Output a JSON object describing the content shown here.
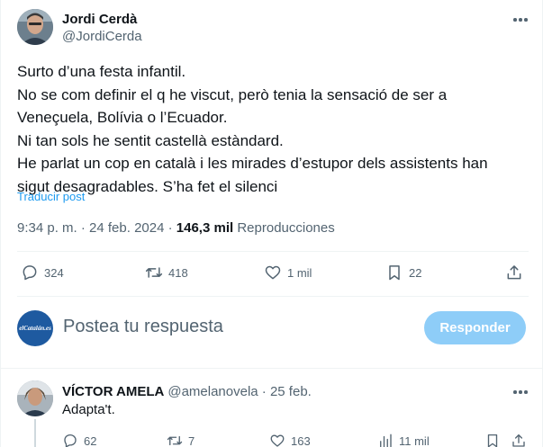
{
  "author": {
    "name": "Jordi Cerdà",
    "handle": "@JordiCerda"
  },
  "tweet": {
    "lines": [
      "Surto d’una festa infantil.",
      "No se com definir el q he viscut, però tenia la sensació de ser a",
      "Veneçuela, Bolívia o l’Ecuador.",
      "Ni tan sols he sentit castellà estàndard.",
      "He parlat un cop en català i les mirades d’estupor dels assistents han",
      "sigut desagradables. S’ha fet el silenci"
    ],
    "translate_label": "Traducir post",
    "time": "9:34 p. m. · 24 feb. 2024 · ",
    "views": "146,3 mil",
    "views_label": " Reproducciones"
  },
  "actions": {
    "replies": "324",
    "reposts": "418",
    "likes": "1 mil",
    "bookmarks": "22"
  },
  "compose": {
    "avatar_text": "elCatalán.es",
    "placeholder": "Postea tu respuesta",
    "button_label": "Responder"
  },
  "reply": {
    "name": "VÍCTOR AMELA",
    "handle": "@amelanovela · 25 feb.",
    "text": "Adapta't.",
    "replies": "62",
    "reposts": "7",
    "likes": "163",
    "views": "11 mil"
  },
  "colors": {
    "accent": "#1d9bf0",
    "button_disabled": "#8ecdf8",
    "secondary_text": "#536471"
  }
}
